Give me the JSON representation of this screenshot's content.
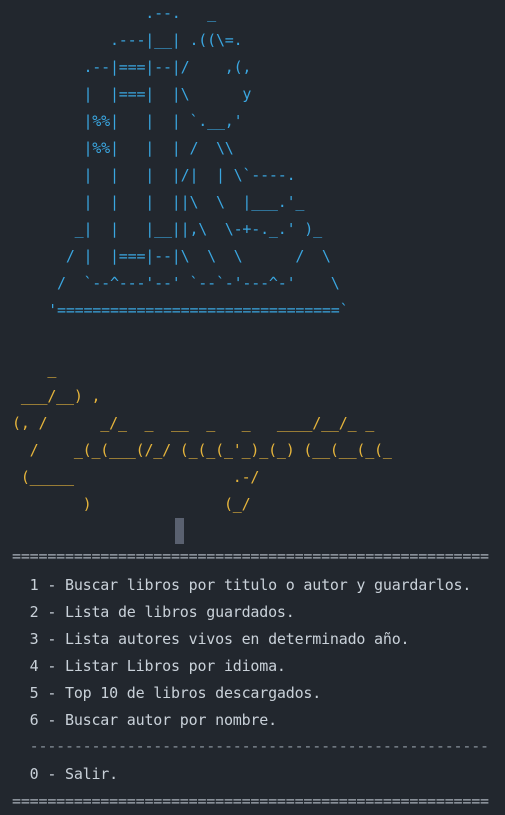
{
  "books_art": "                .--.   _\n            .---|__| .((\\=.\n         .--|===|--|/    ,(,\n         |  |===|  |\\      y\n         |%%|   |  | `.__,'\n         |%%|   |  | /  \\\\\n         |  |   |  |/|  | \\`----.\n         |  |   |  ||\\  \\  |___.'_\n        _|  |   |__||,\\  \\-+-._.' )_\n       / |  |===|--|\\  \\  \\      /  \\\n      /  `--^---'--' `--`-'---^-'    \\\n     '================================`",
  "title_art": "    _\n ___/__) ,\n(, /      _/_  _  __  _   _   ____/__/_ _\n  /    _(_(___(/_/ (_(_(_'_)_(_) (__(__(_(_\n (_____                  .-/\n        )               (_/",
  "menu": {
    "separator_top": "======================================================",
    "options": [
      "  1 - Buscar libros por titulo o autor y guardarlos.",
      "  2 - Lista de libros guardados.",
      "  3 - Lista autores vivos en determinado año.",
      "  4 - Listar Libros por idioma.",
      "  5 - Top 10 de libros descargados.",
      "  6 - Buscar autor por nombre."
    ],
    "divider": "  ----------------------------------------------------",
    "exit_option": "  0 - Salir.",
    "separator_bottom": "======================================================"
  },
  "colors": {
    "background": "#22272e",
    "books_art": "#3aa6e0",
    "title_art": "#e5b43c",
    "text": "#c9d1d9"
  }
}
